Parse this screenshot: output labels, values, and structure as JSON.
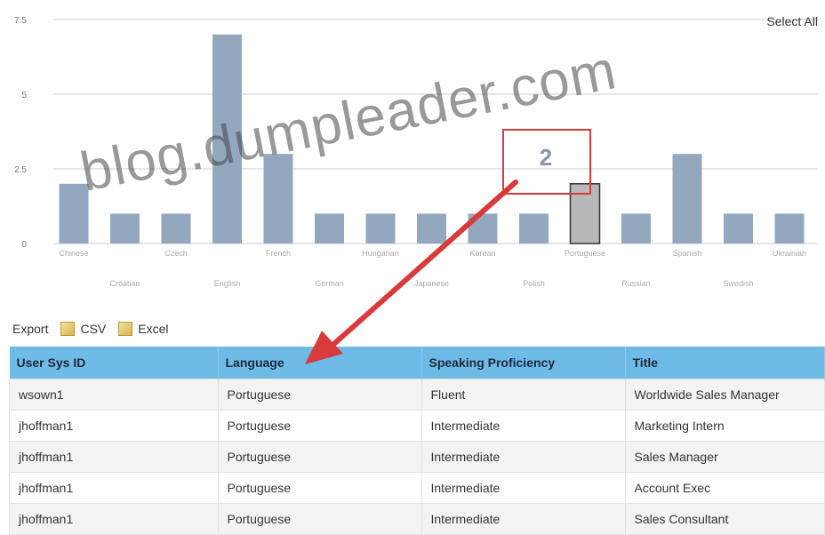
{
  "chart_data": {
    "type": "bar",
    "categories": [
      "Chinese",
      "Croatian",
      "Czech",
      "English",
      "French",
      "German",
      "Hungarian",
      "Japanese",
      "Korean",
      "Polish",
      "Portuguese",
      "Russian",
      "Spanish",
      "Swedish",
      "Ukrainian"
    ],
    "values": [
      2,
      1,
      1,
      7,
      3,
      1,
      1,
      1,
      1,
      1,
      2,
      1,
      3,
      1,
      1
    ],
    "highlighted_category": "Portuguese",
    "highlight_label": "2",
    "ylim": [
      0,
      7.5
    ],
    "yticks": [
      "0",
      "2.5",
      "5",
      "7.5"
    ],
    "colors": {
      "bar": "#93a8bf",
      "highlight": "#b8b8b8",
      "grid": "#cccccc"
    },
    "grid": true
  },
  "select_all": "Select All",
  "export": {
    "label": "Export",
    "csv": "CSV",
    "excel": "Excel"
  },
  "table": {
    "headers": [
      "User Sys ID",
      "Language",
      "Speaking Proficiency",
      "Title"
    ],
    "rows": [
      [
        "wsown1",
        "Portuguese",
        "Fluent",
        "Worldwide Sales Manager"
      ],
      [
        "jhoffman1",
        "Portuguese",
        "Intermediate",
        "Marketing Intern"
      ],
      [
        "jhoffman1",
        "Portuguese",
        "Intermediate",
        "Sales Manager"
      ],
      [
        "jhoffman1",
        "Portuguese",
        "Intermediate",
        "Account Exec"
      ],
      [
        "jhoffman1",
        "Portuguese",
        "Intermediate",
        "Sales Consultant"
      ]
    ]
  },
  "annotation": {
    "callout": "2",
    "arrow_color": "#d93a3a"
  },
  "watermark": "blog.dumpleader.com"
}
